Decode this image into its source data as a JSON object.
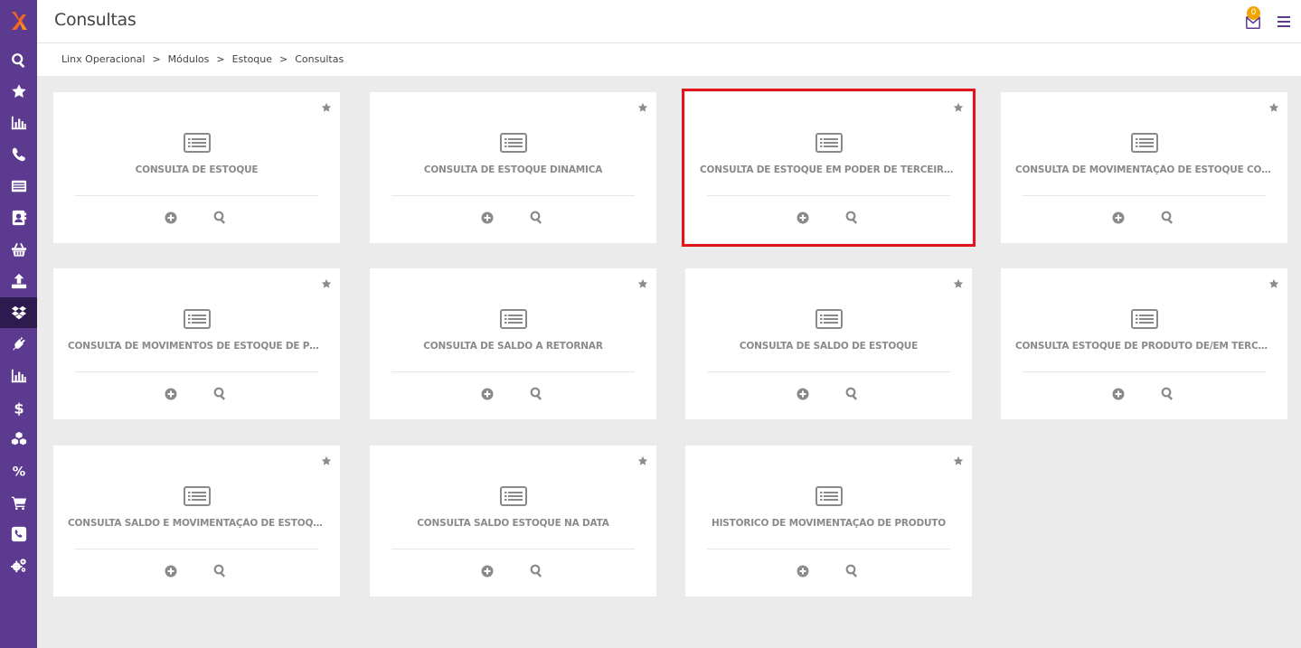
{
  "app": {
    "page_title": "Consultas",
    "notification_count": "0"
  },
  "breadcrumb": {
    "items": [
      "Linx Operacional",
      "Módulos",
      "Estoque",
      "Consultas"
    ],
    "separator": ">"
  },
  "sidebar": {
    "items": [
      {
        "icon": "search-icon"
      },
      {
        "icon": "star-icon"
      },
      {
        "icon": "bar-chart-icon"
      },
      {
        "icon": "phone-icon"
      },
      {
        "icon": "list-icon"
      },
      {
        "icon": "contact-card-icon"
      },
      {
        "icon": "basket-icon"
      },
      {
        "icon": "upload-icon"
      },
      {
        "icon": "dropbox-icon",
        "active": true
      },
      {
        "icon": "plug-icon"
      },
      {
        "icon": "bar-chart-icon"
      },
      {
        "icon": "dollar-icon"
      },
      {
        "icon": "cubes-icon"
      },
      {
        "icon": "percent-icon"
      },
      {
        "icon": "cart-icon"
      },
      {
        "icon": "phone-square-icon"
      },
      {
        "icon": "cogs-icon"
      }
    ]
  },
  "cards": [
    {
      "title": "CONSULTA DE ESTOQUE"
    },
    {
      "title": "CONSULTA DE ESTOQUE DINÂMICA"
    },
    {
      "title": "CONSULTA DE ESTOQUE EM PODER DE TERCEIROS",
      "selected": true
    },
    {
      "title": "CONSULTA DE MOVIMENTAÇÃO DE ESTOQUE COM VENDAS"
    },
    {
      "title": "CONSULTA DE MOVIMENTOS DE ESTOQUE DE PRODUTOS"
    },
    {
      "title": "CONSULTA DE SALDO A RETORNAR"
    },
    {
      "title": "CONSULTA DE SALDO DE ESTOQUE"
    },
    {
      "title": "CONSULTA ESTOQUE DE PRODUTO DE/EM TERCEIRO"
    },
    {
      "title": "CONSULTA SALDO E MOVIMENTAÇÃO DE ESTOQUE"
    },
    {
      "title": "CONSULTA SALDO ESTOQUE NA DATA"
    },
    {
      "title": "HISTÓRICO DE MOVIMENTAÇÃO DE PRODUTO"
    }
  ],
  "colors": {
    "sidebar_bg": "#5b3a8f",
    "sidebar_active": "#2d1a4f",
    "selected_outline": "#e2141c",
    "badge": "#f2a500",
    "card_text": "#8a8a8a"
  }
}
